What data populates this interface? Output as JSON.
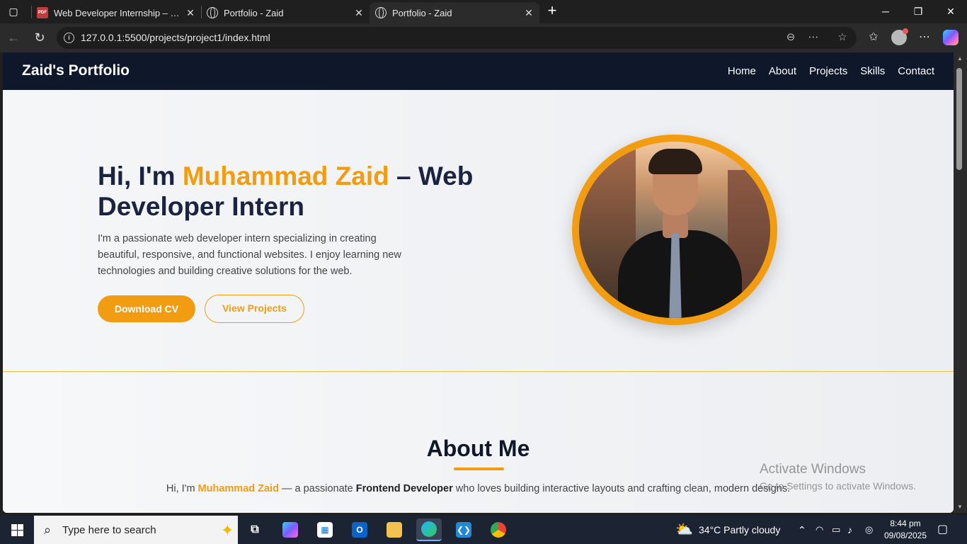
{
  "browser": {
    "tabs": [
      {
        "title": "Web Developer Internship – Proje",
        "icon": "pdf-icon"
      },
      {
        "title": "Portfolio - Zaid",
        "icon": "globe-icon"
      },
      {
        "title": "Portfolio - Zaid",
        "icon": "globe-icon",
        "active": true
      }
    ],
    "url": "127.0.0.1:5500/projects/project1/index.html"
  },
  "site": {
    "brand": "Zaid's Portfolio",
    "nav": [
      "Home",
      "About",
      "Projects",
      "Skills",
      "Contact"
    ]
  },
  "hero": {
    "title_pre": "Hi, I'm ",
    "title_name": "Muhammad Zaid",
    "title_post": " – Web Developer Intern",
    "description": "I'm a passionate web developer intern specializing in creating beautiful, responsive, and functional websites. I enjoy learning new technologies and building creative solutions for the web.",
    "primary_button": "Download CV",
    "secondary_button": "View Projects"
  },
  "about": {
    "title": "About Me",
    "intro_pre": "Hi, I'm ",
    "intro_name": "Muhammad Zaid",
    "intro_mid": " — a passionate ",
    "intro_role": "Frontend Developer",
    "intro_post": " who loves building interactive layouts and crafting clean, modern designs."
  },
  "watermark": {
    "line1": "Activate Windows",
    "line2": "Go to Settings to activate Windows."
  },
  "taskbar": {
    "search_placeholder": "Type here to search",
    "weather": "34°C  Partly cloudy",
    "time": "8:44 pm",
    "date": "09/08/2025"
  },
  "colors": {
    "accent": "#f29c11",
    "navy": "#0f172a",
    "heading": "#1a2340"
  }
}
